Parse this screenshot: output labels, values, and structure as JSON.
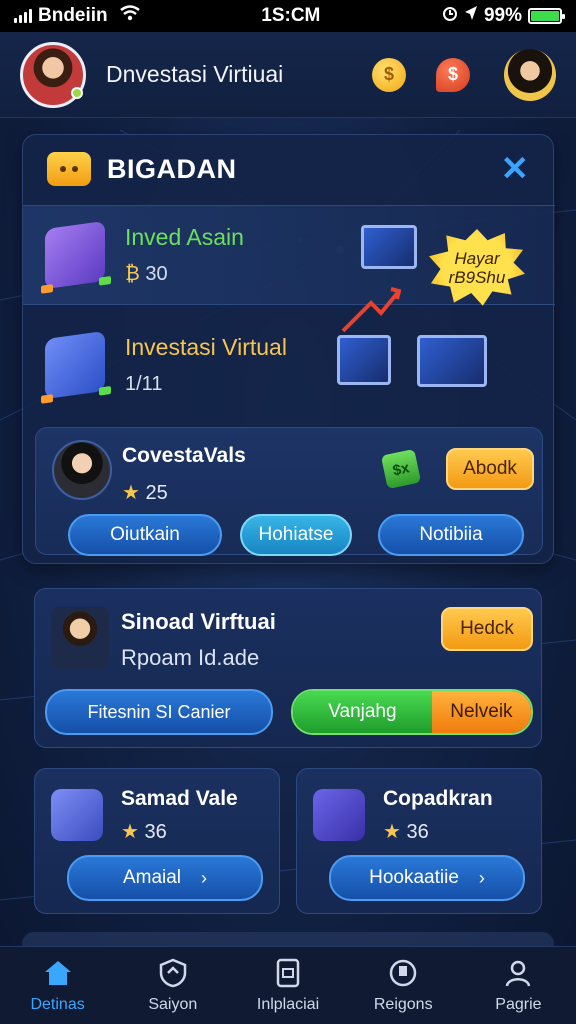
{
  "status_bar": {
    "carrier": "Bndeiin",
    "time": "1S:CM",
    "battery": "99%",
    "battery_level": 0.99
  },
  "header": {
    "title": "Dnvestasi Virtiuai"
  },
  "panel": {
    "title": "BIGADAN",
    "rows": [
      {
        "title": "Inved Asain",
        "value": "30",
        "value_icon": "₿"
      },
      {
        "title": "Investasi Virtual",
        "value": "1/11"
      }
    ],
    "badge": {
      "line1": "Hayar",
      "line2": "rB9Shu"
    },
    "profile": {
      "name": "CovestaVals",
      "value": "25",
      "value_icon": "★",
      "action_label": "Abodk",
      "buttons": [
        "Oiutkain",
        "Hohiatse",
        "Notibiia"
      ]
    }
  },
  "card2": {
    "title": "Sinoad Virftuai",
    "subtitle": "Rpoam Id.ade",
    "action_label": "Hedck",
    "button_label": "Fitesnin SI Canier",
    "split_left": "Vanjahg",
    "split_right": "Nelveik"
  },
  "mini_cards": [
    {
      "title": "Samad Vale",
      "value": "36",
      "value_icon": "★",
      "button_label": "Amaial"
    },
    {
      "title": "Copadkran",
      "value": "36",
      "value_icon": "★",
      "button_label": "Hookaatiie"
    }
  ],
  "tabs": [
    {
      "label": "Detinas",
      "icon": "home-icon",
      "active": true
    },
    {
      "label": "Saiyon",
      "icon": "shield-icon",
      "active": false
    },
    {
      "label": "Inlplaciai",
      "icon": "document-icon",
      "active": false
    },
    {
      "label": "Reigons",
      "icon": "badge-icon",
      "active": false
    },
    {
      "label": "Pagrie",
      "icon": "person-icon",
      "active": false
    }
  ],
  "colors": {
    "background": "#0e1a33",
    "accent_blue": "#39a6ff",
    "accent_orange": "#f39a13",
    "accent_green": "#49d951",
    "gold": "#f6c64f"
  }
}
